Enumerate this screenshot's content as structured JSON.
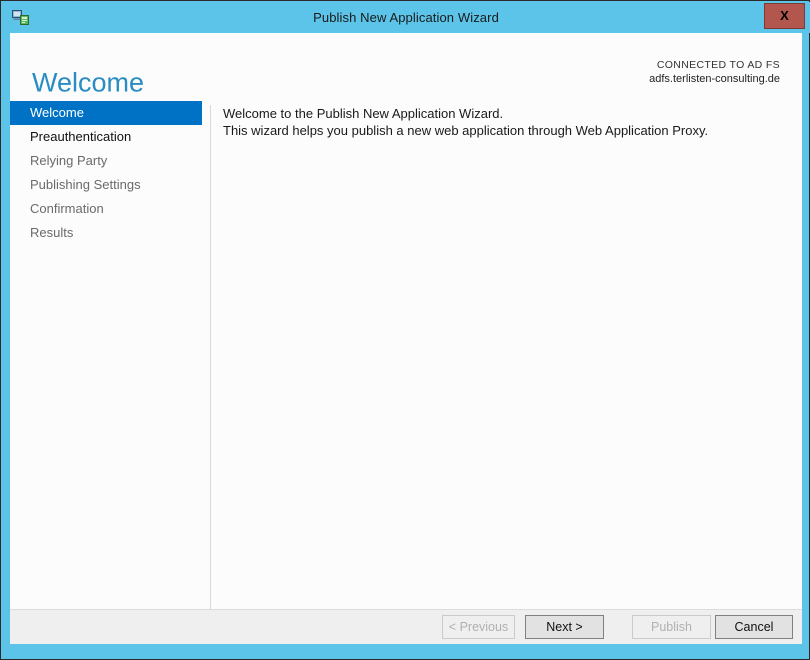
{
  "window": {
    "title": "Publish New Application Wizard",
    "icon": "network-application-icon",
    "close_label": "X",
    "frame_color": "#5bc4e8",
    "close_button_color": "#b3564d"
  },
  "header": {
    "page_title": "Welcome",
    "connected_label": "CONNECTED TO AD FS",
    "connected_server": "adfs.terlisten-consulting.de",
    "title_color": "#2a8cc4"
  },
  "sidebar": {
    "selected_color": "#0072c6",
    "items": [
      {
        "label": "Welcome",
        "state": "selected"
      },
      {
        "label": "Preauthentication",
        "state": "enabled"
      },
      {
        "label": "Relying Party",
        "state": "disabled"
      },
      {
        "label": "Publishing Settings",
        "state": "disabled"
      },
      {
        "label": "Confirmation",
        "state": "disabled"
      },
      {
        "label": "Results",
        "state": "disabled"
      }
    ]
  },
  "content": {
    "lines": [
      "Welcome to the Publish New Application Wizard.",
      "This wizard helps you publish a new web application through Web Application Proxy."
    ]
  },
  "footer": {
    "buttons": [
      {
        "label": "< Previous",
        "state": "disabled"
      },
      {
        "label": "Next >",
        "state": "enabled"
      },
      {
        "label": "Publish",
        "state": "disabled"
      },
      {
        "label": "Cancel",
        "state": "enabled"
      }
    ]
  }
}
